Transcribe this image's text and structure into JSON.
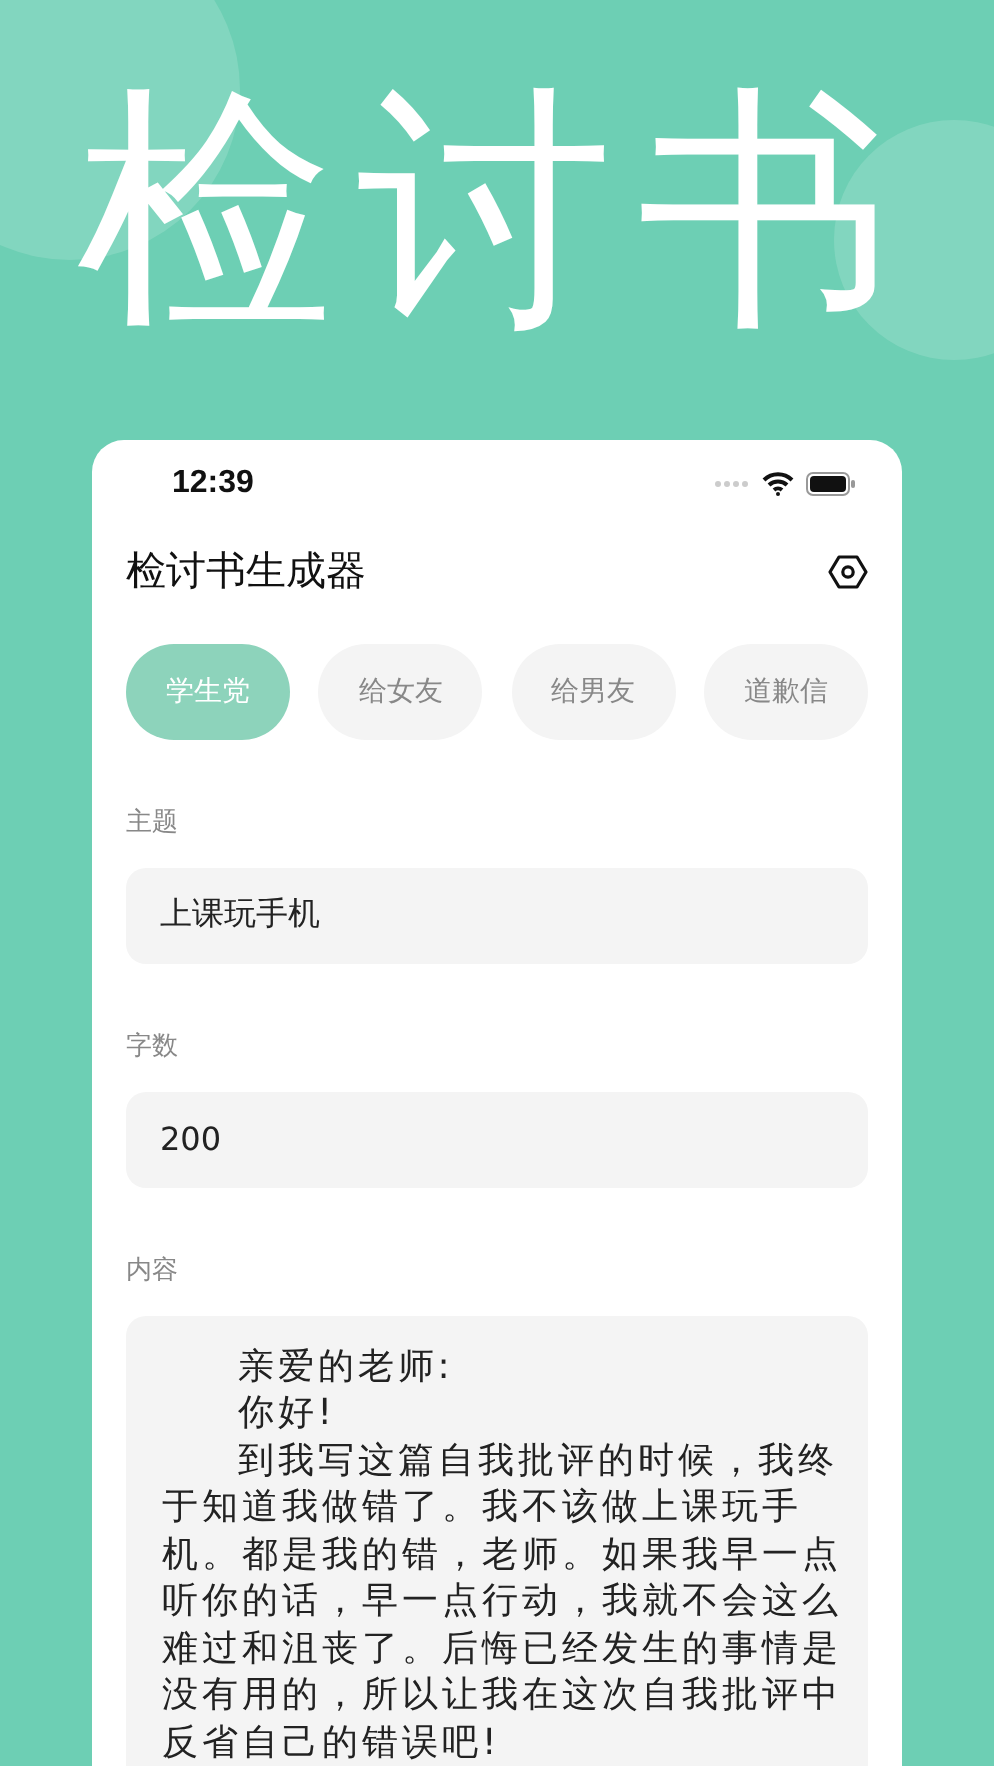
{
  "banner": {
    "title": "检讨书"
  },
  "status_bar": {
    "time": "12:39"
  },
  "header": {
    "title": "检讨书生成器"
  },
  "tabs": [
    {
      "label": "学生党",
      "selected": true
    },
    {
      "label": "给女友",
      "selected": false
    },
    {
      "label": "给男友",
      "selected": false
    },
    {
      "label": "道歉信",
      "selected": false
    }
  ],
  "fields": [
    {
      "label": "主题",
      "value": "上课玩手机"
    },
    {
      "label": "字数",
      "value": "200"
    }
  ],
  "content": {
    "label": "内容",
    "paragraphs": [
      "亲爱的老师:",
      "你好!",
      "到我写这篇自我批评的时候，我终于知道我做错了。我不该做上课玩手机。都是我的错，老师。如果我早一点听你的话，早一点行动，我就不会这么难过和沮丧了。后悔已经发生的事情是没有用的，所以让我在这次自我批评中反省自己的错误吧!"
    ]
  }
}
